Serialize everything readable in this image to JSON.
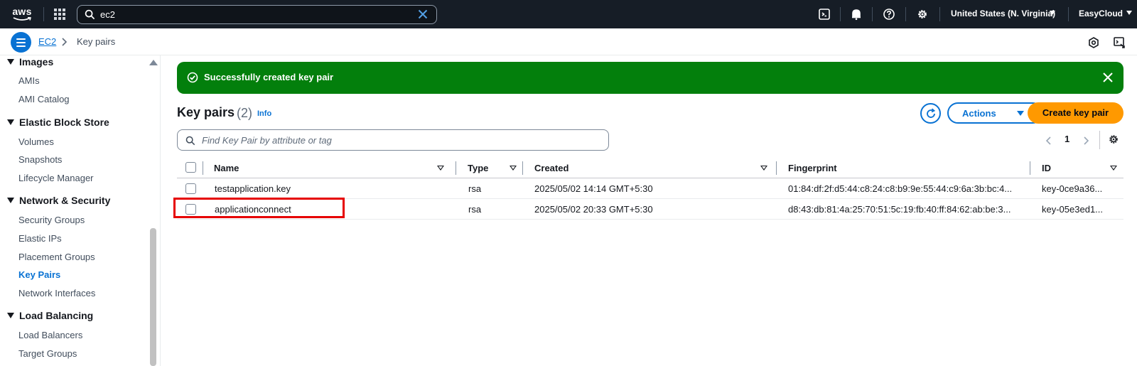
{
  "topnav": {
    "logo_text": "aws",
    "search_value": "ec2",
    "region": "United States (N. Virginia)",
    "account": "EasyCloud",
    "icons": [
      "cloudshell-icon",
      "bell-icon",
      "help-icon",
      "gear-icon"
    ]
  },
  "breadcrumb": {
    "parent": "EC2",
    "current": "Key pairs"
  },
  "sidebar": {
    "sections": [
      {
        "title": "Images",
        "items": [
          "AMIs",
          "AMI Catalog"
        ]
      },
      {
        "title": "Elastic Block Store",
        "items": [
          "Volumes",
          "Snapshots",
          "Lifecycle Manager"
        ]
      },
      {
        "title": "Network & Security",
        "items": [
          "Security Groups",
          "Elastic IPs",
          "Placement Groups",
          "Key Pairs",
          "Network Interfaces"
        ]
      },
      {
        "title": "Load Balancing",
        "items": [
          "Load Balancers",
          "Target Groups"
        ]
      }
    ],
    "active_item": "Key Pairs"
  },
  "flash": {
    "message": "Successfully created key pair",
    "color": "#037f0c"
  },
  "page": {
    "title": "Key pairs",
    "count": "(2)",
    "info": "Info",
    "actions_label": "Actions",
    "create_label": "Create key pair",
    "filter_placeholder": "Find Key Pair by attribute or tag",
    "page_number": "1"
  },
  "table": {
    "columns": [
      "Name",
      "Type",
      "Created",
      "Fingerprint",
      "ID"
    ],
    "rows": [
      {
        "name": "testapplication.key",
        "type": "rsa",
        "created": "2025/05/02 14:14 GMT+5:30",
        "fingerprint": "01:84:df:2f:d5:44:c8:24:c8:b9:9e:55:44:c9:6a:3b:bc:4...",
        "id": "key-0ce9a36..."
      },
      {
        "name": "applicationconnect",
        "type": "rsa",
        "created": "2025/05/02 20:33 GMT+5:30",
        "fingerprint": "d8:43:db:81:4a:25:70:51:5c:19:fb:40:ff:84:62:ab:be:3...",
        "id": "key-05e3ed1..."
      }
    ]
  },
  "colors": {
    "accent": "#0972d3",
    "primary_button": "#ff9900",
    "nav_bg": "#161d26",
    "highlight": "#e60000"
  }
}
